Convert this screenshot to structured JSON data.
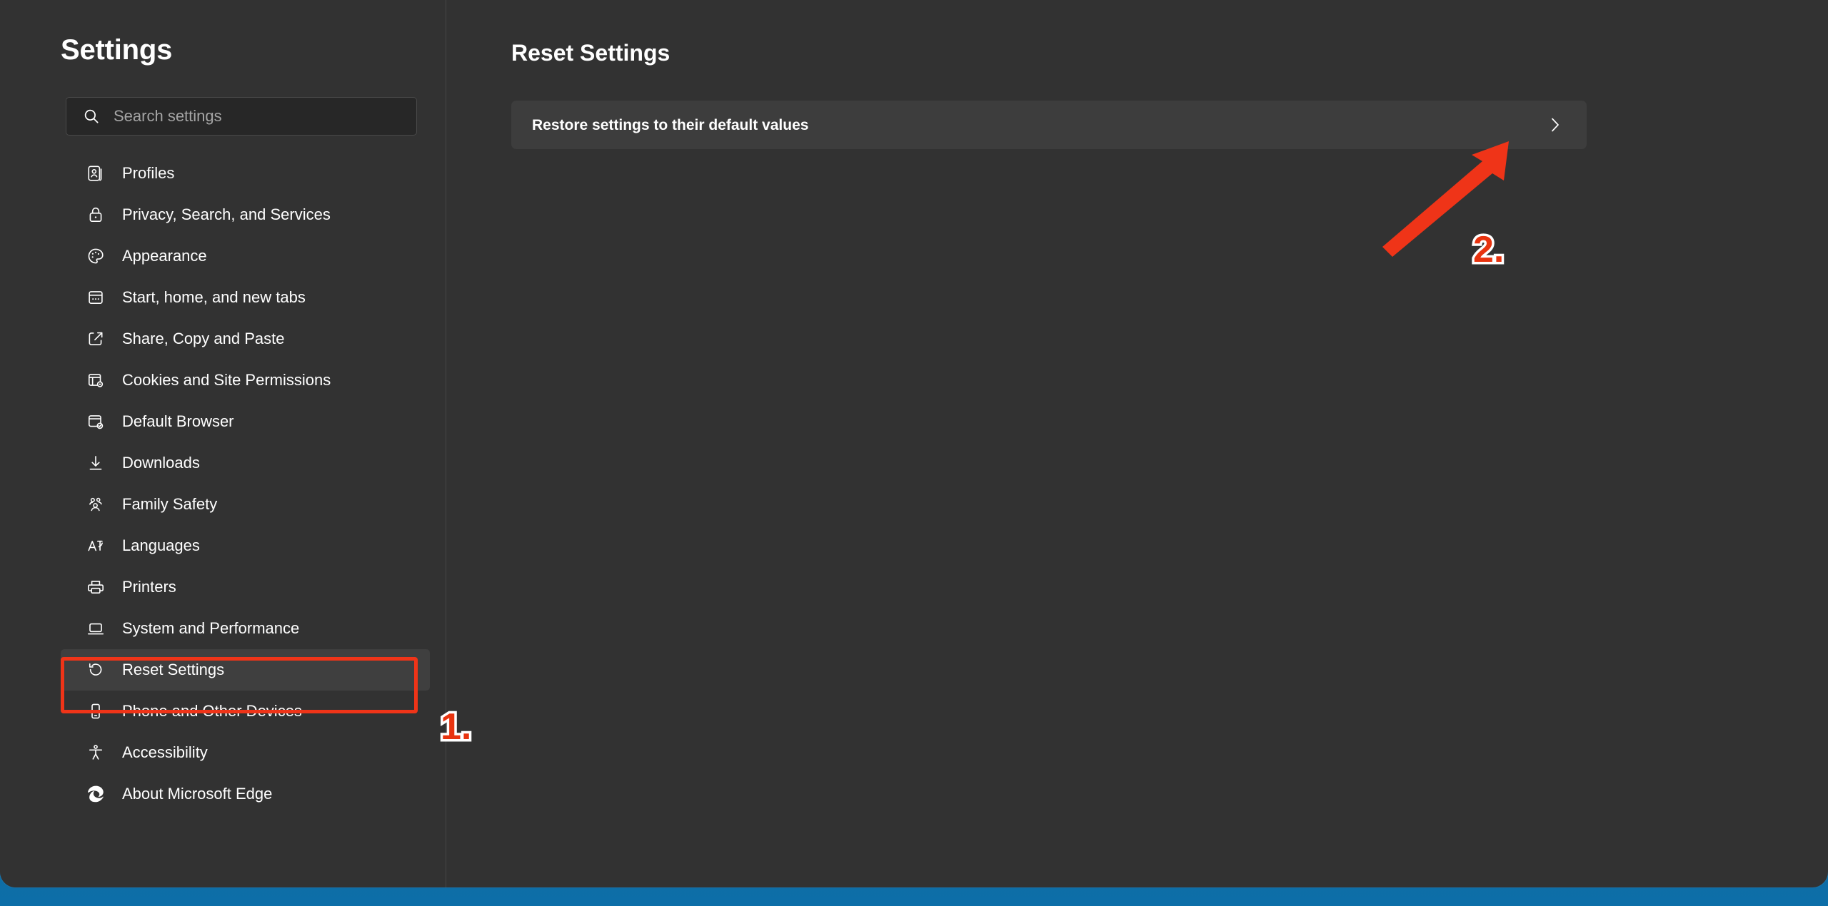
{
  "window": {
    "accent_blue": "#4aa0e6",
    "background": "#323232",
    "card_background": "#3d3d3d"
  },
  "sidebar": {
    "title": "Settings",
    "search": {
      "placeholder": "Search settings",
      "value": "",
      "icon": "search-icon"
    },
    "items": [
      {
        "label": "Profiles",
        "icon": "profiles-icon",
        "selected": false
      },
      {
        "label": "Privacy, Search, and Services",
        "icon": "lock-icon",
        "selected": false
      },
      {
        "label": "Appearance",
        "icon": "palette-icon",
        "selected": false
      },
      {
        "label": "Start, home, and new tabs",
        "icon": "browser-window-icon",
        "selected": false
      },
      {
        "label": "Share, Copy and Paste",
        "icon": "share-icon",
        "selected": false
      },
      {
        "label": "Cookies and Site Permissions",
        "icon": "site-permissions-icon",
        "selected": false
      },
      {
        "label": "Default Browser",
        "icon": "default-browser-icon",
        "selected": false
      },
      {
        "label": "Downloads",
        "icon": "download-icon",
        "selected": false
      },
      {
        "label": "Family Safety",
        "icon": "family-icon",
        "selected": false
      },
      {
        "label": "Languages",
        "icon": "languages-icon",
        "selected": false
      },
      {
        "label": "Printers",
        "icon": "printer-icon",
        "selected": false
      },
      {
        "label": "System and Performance",
        "icon": "laptop-icon",
        "selected": false
      },
      {
        "label": "Reset Settings",
        "icon": "reset-icon",
        "selected": true
      },
      {
        "label": "Phone and Other Devices",
        "icon": "phone-icon",
        "selected": false
      },
      {
        "label": "Accessibility",
        "icon": "accessibility-icon",
        "selected": false
      },
      {
        "label": "About Microsoft Edge",
        "icon": "edge-logo-icon",
        "selected": false
      }
    ]
  },
  "main": {
    "title": "Reset Settings",
    "reset_row": {
      "label": "Restore settings to their default values",
      "chevron": "chevron-right-icon"
    }
  },
  "annotations": {
    "color": "#e8330f",
    "outline_color": "#ffffff",
    "step_1": "1.",
    "step_2": "2.",
    "arrow": "red-arrow-annotation"
  }
}
